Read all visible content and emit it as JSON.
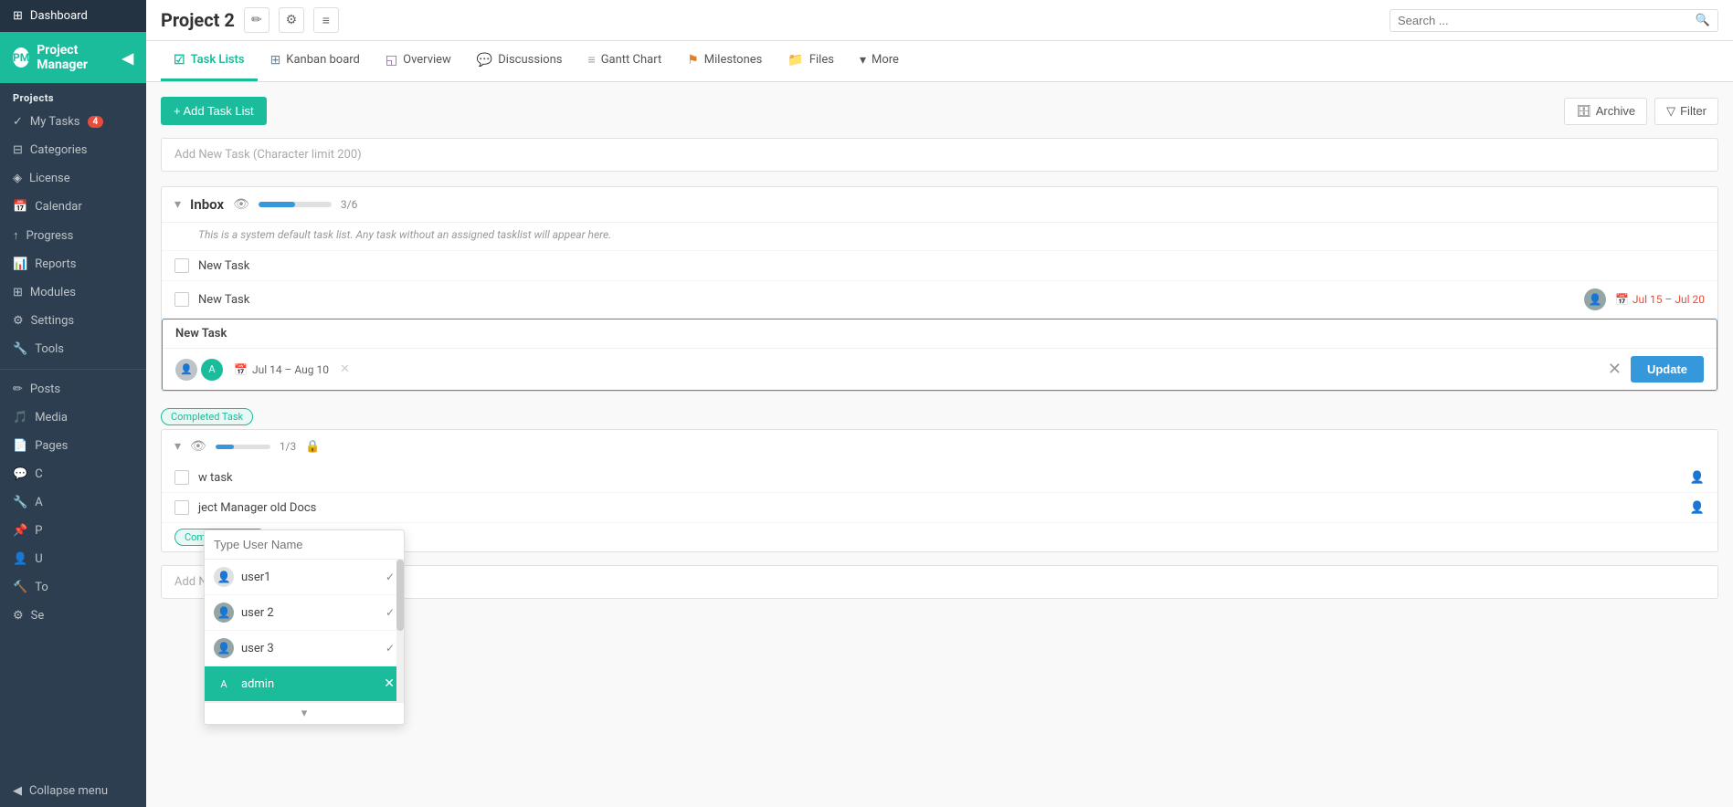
{
  "sidebar": {
    "dashboard_label": "Dashboard",
    "project_manager_label": "Project Manager",
    "projects_label": "Projects",
    "my_tasks_label": "My Tasks",
    "my_tasks_badge": "4",
    "categories_label": "Categories",
    "license_label": "License",
    "calendar_label": "Calendar",
    "progress_label": "Progress",
    "reports_label": "Reports",
    "modules_label": "Modules",
    "settings_label": "Settings",
    "tools_label": "Tools",
    "posts_label": "Posts",
    "media_label": "Media",
    "pages_label": "Pages",
    "collapse_label": "Collapse menu"
  },
  "header": {
    "title": "Project 2",
    "search_placeholder": "Search ..."
  },
  "tabs": [
    {
      "label": "Task Lists",
      "icon": "☑",
      "active": true
    },
    {
      "label": "Kanban board",
      "icon": "⊞",
      "active": false
    },
    {
      "label": "Overview",
      "icon": "◱",
      "active": false
    },
    {
      "label": "Discussions",
      "icon": "💬",
      "active": false
    },
    {
      "label": "Gantt Chart",
      "icon": "≡",
      "active": false
    },
    {
      "label": "Milestones",
      "icon": "⚑",
      "active": false
    },
    {
      "label": "Files",
      "icon": "📁",
      "active": false
    },
    {
      "label": "More",
      "icon": "▾",
      "active": false
    }
  ],
  "toolbar": {
    "add_task_list_label": "+ Add Task List",
    "archive_label": "Archive",
    "filter_label": "Filter"
  },
  "add_task_placeholder": "Add New Task (Character limit 200)",
  "inbox_section": {
    "title": "Inbox",
    "progress": 50,
    "count": "3/6",
    "desc": "This is a system default task list. Any task without an assigned tasklist will appear here.",
    "tasks": [
      {
        "name": "New Task",
        "has_assignee": false,
        "date": ""
      },
      {
        "name": "New Task",
        "has_assignee": true,
        "date": "Jul 15 – Jul 20"
      }
    ],
    "expanded_task": {
      "name": "New Task",
      "date": "Jul 14 – Aug 10",
      "update_label": "Update"
    }
  },
  "completed_task_badge": "Completed Task",
  "section2": {
    "title": "",
    "eye_visible": true,
    "progress": 33,
    "count": "1/3",
    "tasks": [
      {
        "name": "w task",
        "has_assignee": true,
        "assignee_icon": "👤"
      },
      {
        "name": "ject Manager old Docs",
        "has_assignee": true,
        "assignee_icon": "👤"
      }
    ]
  },
  "user_dropdown": {
    "search_placeholder": "Type User Name",
    "users": [
      {
        "name": "user1",
        "selected": true,
        "is_admin": false
      },
      {
        "name": "user 2",
        "selected": true,
        "is_admin": false
      },
      {
        "name": "user 3",
        "selected": true,
        "is_admin": false
      },
      {
        "name": "admin",
        "selected": true,
        "is_admin": true
      }
    ]
  }
}
